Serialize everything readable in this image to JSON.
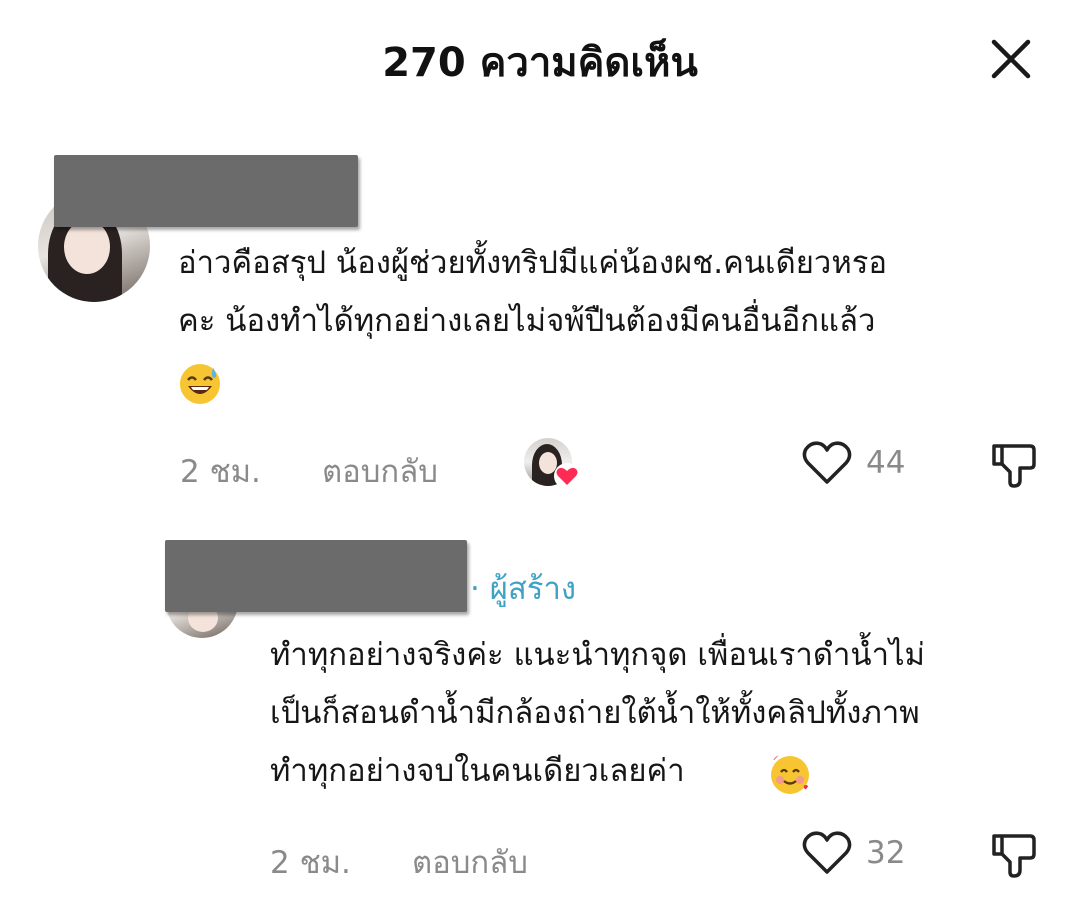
{
  "header": {
    "title": "270 ความคิดเห็น"
  },
  "comments": [
    {
      "text_lines": [
        "อ่าวคือสรุป น้องผู้ช่วยทั้งทริปมีแค่น้องผช.คนเดียวหรอ",
        "คะ น้องทำได้ทุกอย่างเลยไม่จพ้ปืนต้องมีคนอื่นอีกแล้ว"
      ],
      "emoji": "grinning-sweat-emoji",
      "time": "2 ชม.",
      "reply_label": "ตอบกลับ",
      "likes": "44"
    }
  ],
  "reply": {
    "creator_label": "· ผู้สร้าง",
    "text_lines": [
      "ทำทุกอย่างจริงค่ะ แนะนำทุกจุด เพื่อนเราดำน้ำไม่",
      "เป็นก็สอนดำน้ำมีกล้องถ่ายใต้น้ำให้ทั้งคลิปทั้งภาพ",
      "ทำทุกอย่างจบในคนเดียวเลยค่า"
    ],
    "emoji": "smiling-hearts-emoji",
    "time": "2 ชม.",
    "reply_label": "ตอบกลับ",
    "likes": "32"
  }
}
